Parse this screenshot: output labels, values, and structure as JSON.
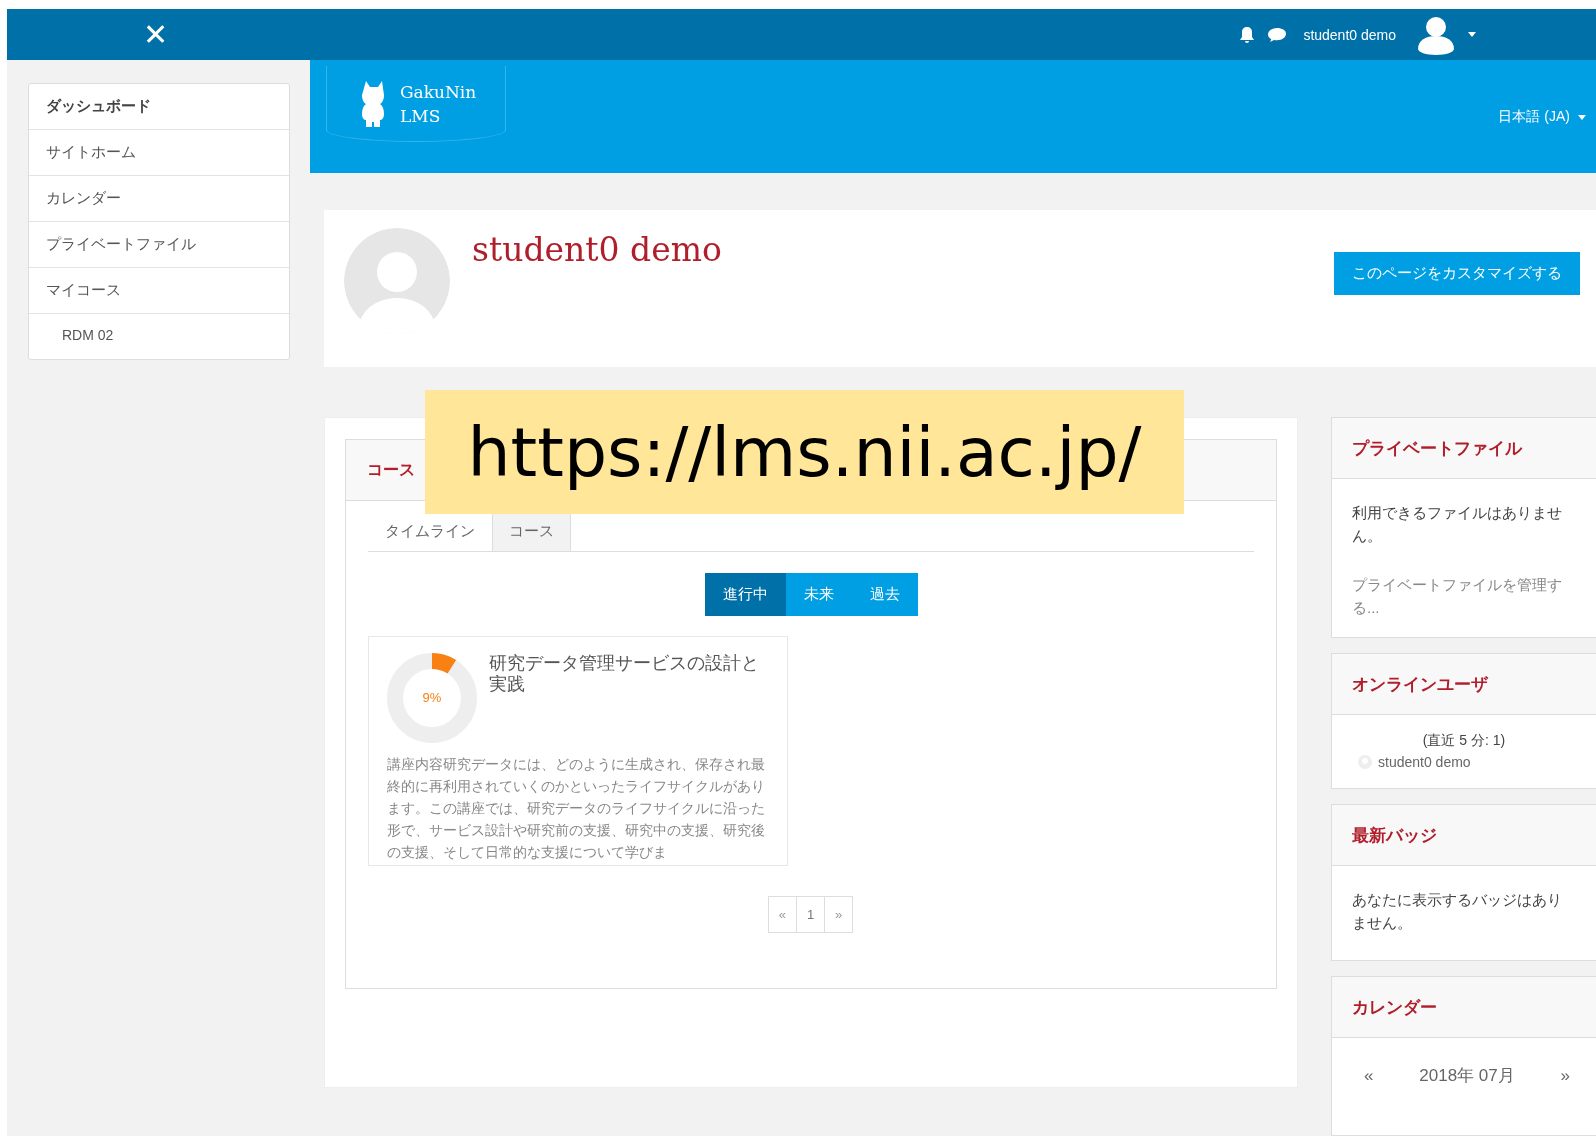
{
  "top_bar": {
    "close_icon": "✕",
    "user_name": "student0 demo"
  },
  "nav": [
    {
      "label": "ダッシュボード",
      "selected": true
    },
    {
      "label": "サイトホーム",
      "selected": false
    },
    {
      "label": "カレンダー",
      "selected": false
    },
    {
      "label": "プライベートファイル",
      "selected": false
    },
    {
      "label": "マイコース",
      "selected": false,
      "children": [
        {
          "label": "RDM 02",
          "selected": false
        }
      ]
    }
  ],
  "header": {
    "logo_line1": "GakuNin",
    "logo_line2": "LMS",
    "language": "日本語 (JA)"
  },
  "profile": {
    "name": "student0 demo",
    "customize_button": "このページをカスタマイズする"
  },
  "course_overview": {
    "title": "コース",
    "tabs": [
      {
        "label": "タイムライン",
        "selected": false
      },
      {
        "label": "コース",
        "selected": true
      }
    ],
    "filters": [
      {
        "label": "進行中",
        "selected": true
      },
      {
        "label": "未来",
        "selected": false
      },
      {
        "label": "過去",
        "selected": false
      }
    ],
    "courses": [
      {
        "progress": {
          "level": 0.09,
          "reading": "9%"
        },
        "title": "研究データ管理サービスの設計と実践",
        "summary": "講座内容研究データには、どのように生成され、保存され最終的に再利用されていくのかといったライフサイクルがあります。この講座では、研究データのライフサイクルに沿った形で、サービス設計や研究前の支援、研究中の支援、研究後の支援、そして日常的な支援について学びま"
      }
    ],
    "pagination": [
      {
        "label": "«",
        "selected": false
      },
      {
        "label": "1",
        "selected": true
      },
      {
        "label": "»",
        "selected": false
      }
    ]
  },
  "blocks": [
    {
      "kind": "files",
      "title": "プライベートファイル",
      "text": "利用できるファイルはありません。",
      "link": "プライベートファイルを管理する..."
    },
    {
      "kind": "users",
      "title": "オンラインユーザ",
      "text": "(直近 5 分: 1)",
      "user": "student0 demo"
    },
    {
      "kind": "badges",
      "title": "最新バッジ",
      "text": "あなたに表示するバッジはありません。"
    },
    {
      "kind": "calendar",
      "title": "カレンダー",
      "prev": "«",
      "month": "2018年 07月",
      "next": "»"
    }
  ],
  "annotation": {
    "text": "https://lms.nii.ac.jp/"
  }
}
